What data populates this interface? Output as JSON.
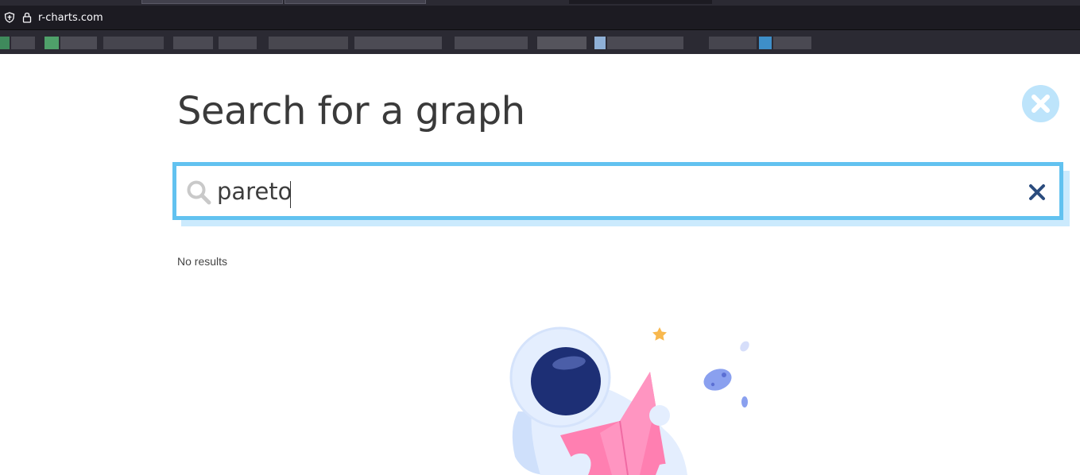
{
  "browser": {
    "url": "r-charts.com"
  },
  "page": {
    "title": "Search for a graph",
    "close_icon": "close-circle-icon"
  },
  "search": {
    "value": "pareto",
    "search_icon": "magnifier-icon",
    "clear_icon": "x-icon"
  },
  "results": {
    "message": "No results"
  },
  "illustration": {
    "name": "astronaut-reading-map-illustration"
  },
  "colors": {
    "accent": "#62c2f0",
    "accent_shadow": "#cbeafd",
    "close_bg": "#bde4fb",
    "clear_x": "#2b4c7e",
    "title_text": "#3a3a3a",
    "chrome_dark": "#1c1b22"
  }
}
